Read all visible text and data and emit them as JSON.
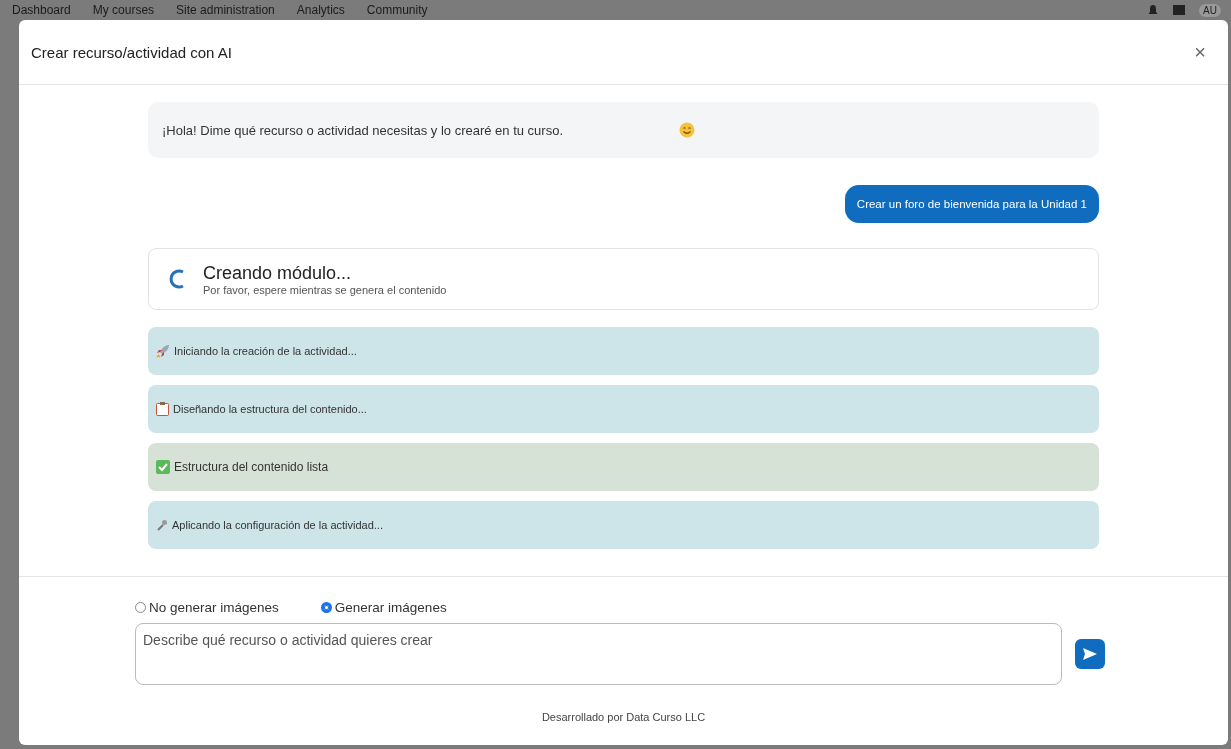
{
  "nav": {
    "items": [
      "Dashboard",
      "My courses",
      "Site administration",
      "Analytics",
      "Community"
    ],
    "avatar": "AU"
  },
  "modal": {
    "title": "Crear recurso/actividad con AI",
    "close": "×"
  },
  "messages": [
    {
      "kind": "bot",
      "text": "¡Hola! Dime qué recurso o actividad necesitas y lo crearé en tu curso.",
      "emoji": true
    },
    {
      "kind": "user",
      "text": "Crear un foro de bienvenida para la Unidad 1"
    }
  ],
  "progress": {
    "title": "Creando módulo...",
    "subtitle": "Por favor, espere mientras se genera el contenido"
  },
  "steps": [
    {
      "kind": "rocket",
      "done": false,
      "text": "Iniciando la creación de la actividad..."
    },
    {
      "kind": "clipboard",
      "done": false,
      "text": "Diseñando la estructura del contenido..."
    },
    {
      "kind": "check",
      "done": true,
      "text": "Estructura del contenido lista"
    },
    {
      "kind": "wrench",
      "done": false,
      "text": "Aplicando la configuración de la actividad..."
    }
  ],
  "image_options": [
    {
      "label": "No generar imágenes",
      "selected": false
    },
    {
      "label": "Generar imágenes",
      "selected": true
    }
  ],
  "prompt": {
    "placeholder": "Describe qué recurso o actividad quieres crear"
  },
  "footer": "Desarrollado por Data Curso LLC"
}
